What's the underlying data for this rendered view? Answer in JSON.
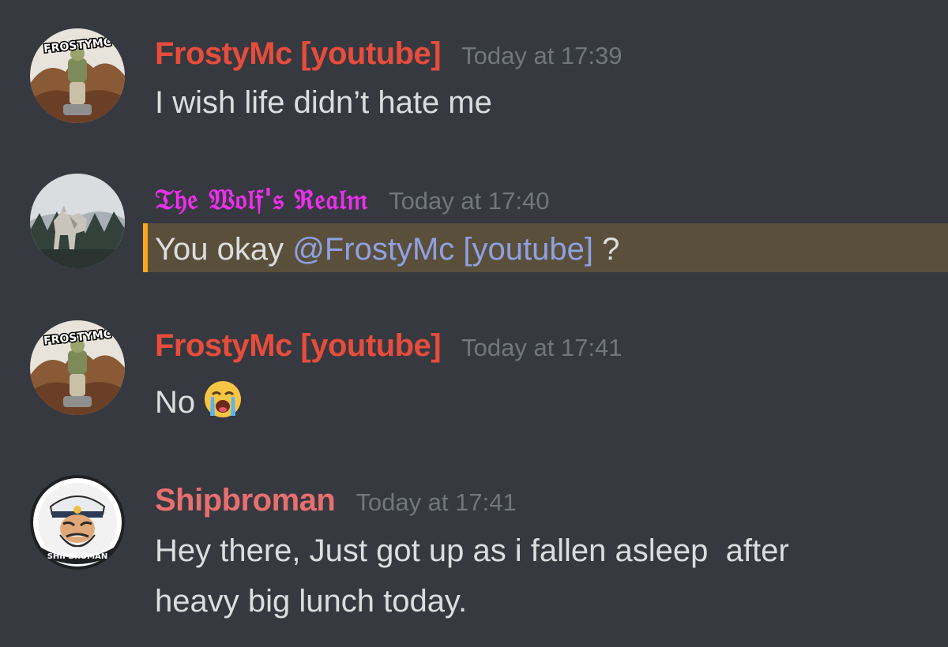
{
  "colors": {
    "background": "#36393f",
    "text": "#dcddde",
    "timestamp": "#72767d",
    "frosty_name": "#e74c3c",
    "wolf_name": "#ed2fed",
    "ship_name": "#e86f6f",
    "mention_text": "#8ea1e1",
    "mention_highlight": "#5a4f3b",
    "mention_bar": "#faa81a"
  },
  "messages": [
    {
      "username": "FrostyMc [youtube]",
      "timestamp": "Today at 17:39",
      "text": "I wish life didn’t hate me",
      "avatar_icon": "frostymc-avatar-icon",
      "avatar_text": "FROSTYMC"
    },
    {
      "username": "𝔗𝔥𝔢 𝔚𝔬𝔩𝔣'𝔰 ℜ𝔢𝔞𝔩𝔪",
      "timestamp": "Today at 17:40",
      "text_before": "You okay ",
      "mention": "@FrostyMc [youtube]",
      "text_after": " ?",
      "avatar_icon": "wolf-avatar-icon"
    },
    {
      "username": "FrostyMc [youtube]",
      "timestamp": "Today at 17:41",
      "text": "No",
      "emoji": "loudly-crying-face-emoji",
      "avatar_icon": "frostymc-avatar-icon",
      "avatar_text": "FROSTYMC"
    },
    {
      "username": "Shipbroman",
      "timestamp": "Today at 17:41",
      "text_line1": "Hey there, Just got up as i fallen asleep  after",
      "text_line2": "heavy big lunch today.",
      "avatar_icon": "shipbroman-avatar-icon",
      "avatar_text": "SHIPBROMAN"
    }
  ]
}
